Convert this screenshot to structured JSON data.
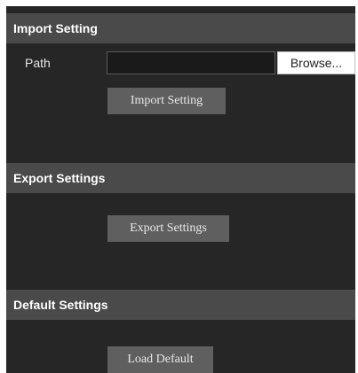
{
  "import_section": {
    "header": "Import Setting",
    "path_label": "Path",
    "path_value": "",
    "browse_label": "Browse...",
    "button_label": "Import Setting"
  },
  "export_section": {
    "header": "Export Settings",
    "button_label": "Export Settings"
  },
  "default_section": {
    "header": "Default Settings",
    "button_label": "Load Default"
  },
  "colors": {
    "panel_background": "#262626",
    "section_header": "#4a4a4a",
    "button_background": "#5f5f5f"
  }
}
